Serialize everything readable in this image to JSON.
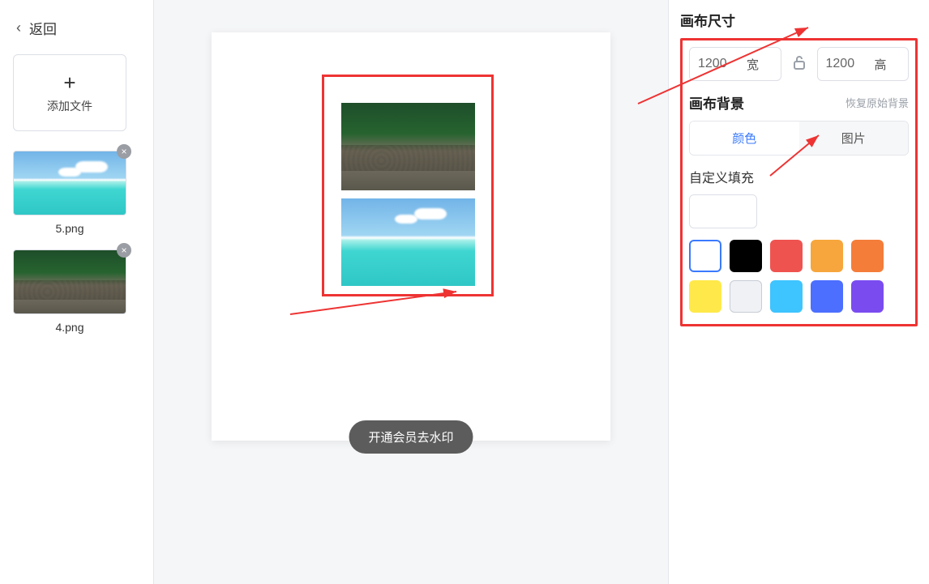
{
  "sidebar": {
    "back_label": "返回",
    "add_label": "添加文件",
    "thumbs": [
      {
        "name": "5.png",
        "kind": "beach"
      },
      {
        "name": "4.png",
        "kind": "forest"
      }
    ]
  },
  "canvas": {
    "watermark_button": "开通会员去水印"
  },
  "panel": {
    "size_title": "画布尺寸",
    "width_value": "1200",
    "width_suffix": "宽",
    "height_value": "1200",
    "height_suffix": "高",
    "bg_title": "画布背景",
    "restore_label": "恢复原始背景",
    "tab_color": "颜色",
    "tab_image": "图片",
    "custom_fill_label": "自定义填充",
    "swatches": {
      "row1": [
        "#ffffff",
        "#000000",
        "#ef5350",
        "#f6a63c",
        "#f47d3a",
        "#ffe94a"
      ],
      "row2": [
        "#eff1f5",
        "#3ec4ff",
        "#4c6fff",
        "#7a4cf0"
      ]
    }
  }
}
